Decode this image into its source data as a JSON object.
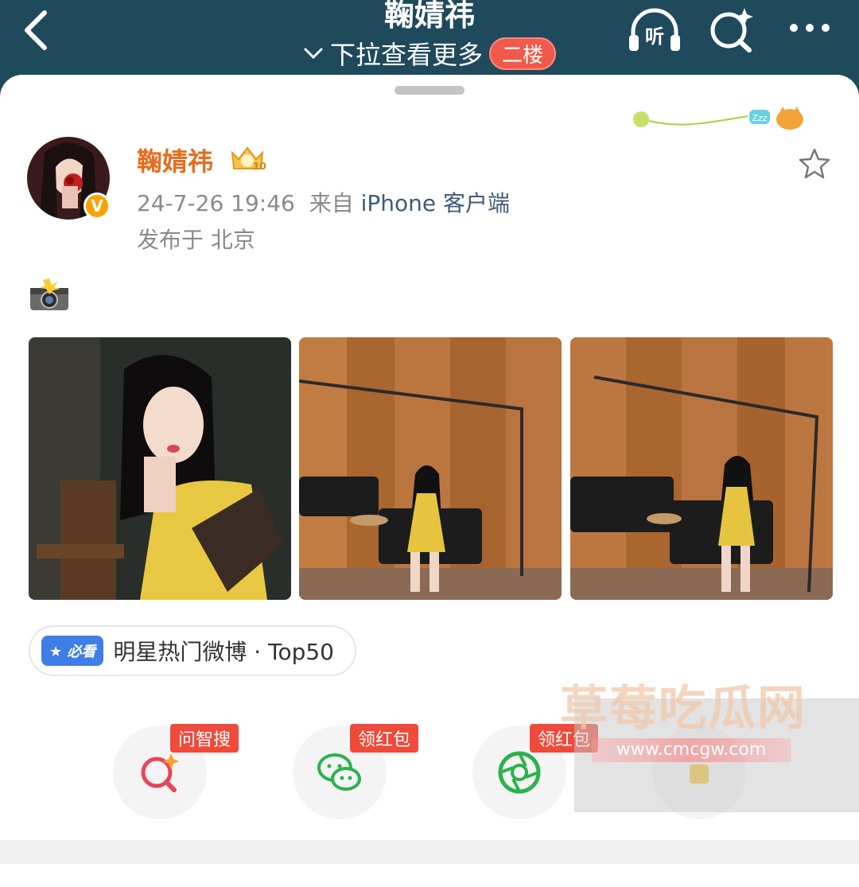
{
  "header": {
    "title": "鞠婧祎",
    "pull_hint": "下拉查看更多",
    "floor_badge": "二楼",
    "listen_label": "听"
  },
  "post": {
    "username": "鞠婧祎",
    "vip_level": "10",
    "verified_mark": "V",
    "date": "24-7-26 19:46",
    "source_prefix": "来自",
    "source": "iPhone 客户端",
    "location": "发布于 北京",
    "content_emoji": "camera-with-flash",
    "photo_count": 3
  },
  "hot_tag": {
    "badge": "必看",
    "text": "明星热门微博 · Top50"
  },
  "share_bar": {
    "items": [
      {
        "icon": "ai-search-icon",
        "label": "问智搜"
      },
      {
        "icon": "wechat-icon",
        "label": "领红包"
      },
      {
        "icon": "moments-icon",
        "label": "领红包"
      },
      {
        "icon": "unknown-icon",
        "label": ""
      }
    ]
  },
  "watermark": {
    "title": "草莓吃瓜网",
    "url": "www.cmcgw.com"
  },
  "colors": {
    "header_bg": "#1f4a5c",
    "username": "#e86b1a",
    "badge_red": "#f04a3a",
    "verified": "#f7a400",
    "must_see_blue": "#3e7ee6"
  }
}
